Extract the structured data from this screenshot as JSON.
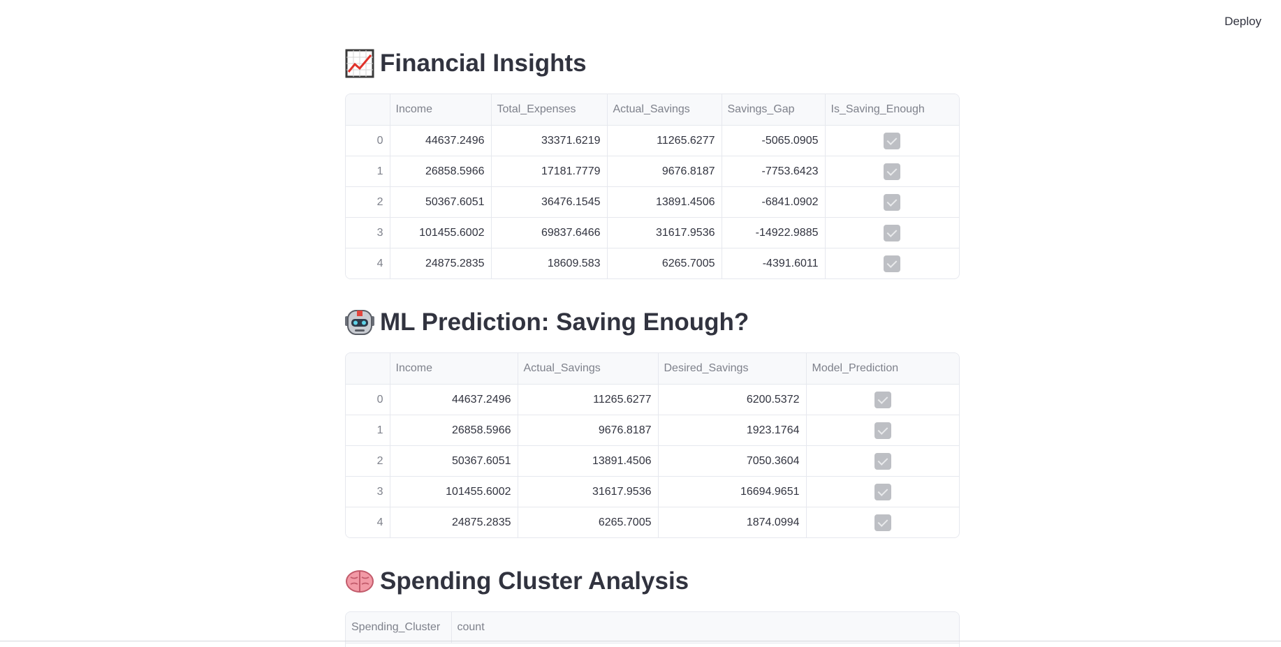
{
  "header": {
    "deploy_label": "Deploy"
  },
  "sections": {
    "insights": {
      "title": "Financial Insights",
      "icon": "chart-increasing-icon",
      "columns": [
        "",
        "Income",
        "Total_Expenses",
        "Actual_Savings",
        "Savings_Gap",
        "Is_Saving_Enough"
      ],
      "rows": [
        [
          "0",
          "44637.2496",
          "33371.6219",
          "11265.6277",
          "-5065.0905",
          true
        ],
        [
          "1",
          "26858.5966",
          "17181.7779",
          "9676.8187",
          "-7753.6423",
          true
        ],
        [
          "2",
          "50367.6051",
          "36476.1545",
          "13891.4506",
          "-6841.0902",
          true
        ],
        [
          "3",
          "101455.6002",
          "69837.6466",
          "31617.9536",
          "-14922.9885",
          true
        ],
        [
          "4",
          "24875.2835",
          "18609.583",
          "6265.7005",
          "-4391.6011",
          true
        ]
      ]
    },
    "prediction": {
      "title": "ML Prediction: Saving Enough?",
      "icon": "robot-icon",
      "columns": [
        "",
        "Income",
        "Actual_Savings",
        "Desired_Savings",
        "Model_Prediction"
      ],
      "rows": [
        [
          "0",
          "44637.2496",
          "11265.6277",
          "6200.5372",
          true
        ],
        [
          "1",
          "26858.5966",
          "9676.8187",
          "1923.1764",
          true
        ],
        [
          "2",
          "50367.6051",
          "13891.4506",
          "7050.3604",
          true
        ],
        [
          "3",
          "101455.6002",
          "31617.9536",
          "16694.9651",
          true
        ],
        [
          "4",
          "24875.2835",
          "6265.7005",
          "1874.0994",
          true
        ]
      ]
    },
    "cluster": {
      "title": "Spending Cluster Analysis",
      "icon": "brain-icon",
      "columns": [
        "Spending_Cluster",
        "count"
      ]
    }
  },
  "colors": {
    "checkbox": "#bdbfc4",
    "header_bg": "#f8f9fb",
    "border": "#e6e8ee",
    "text": "#31333f"
  }
}
